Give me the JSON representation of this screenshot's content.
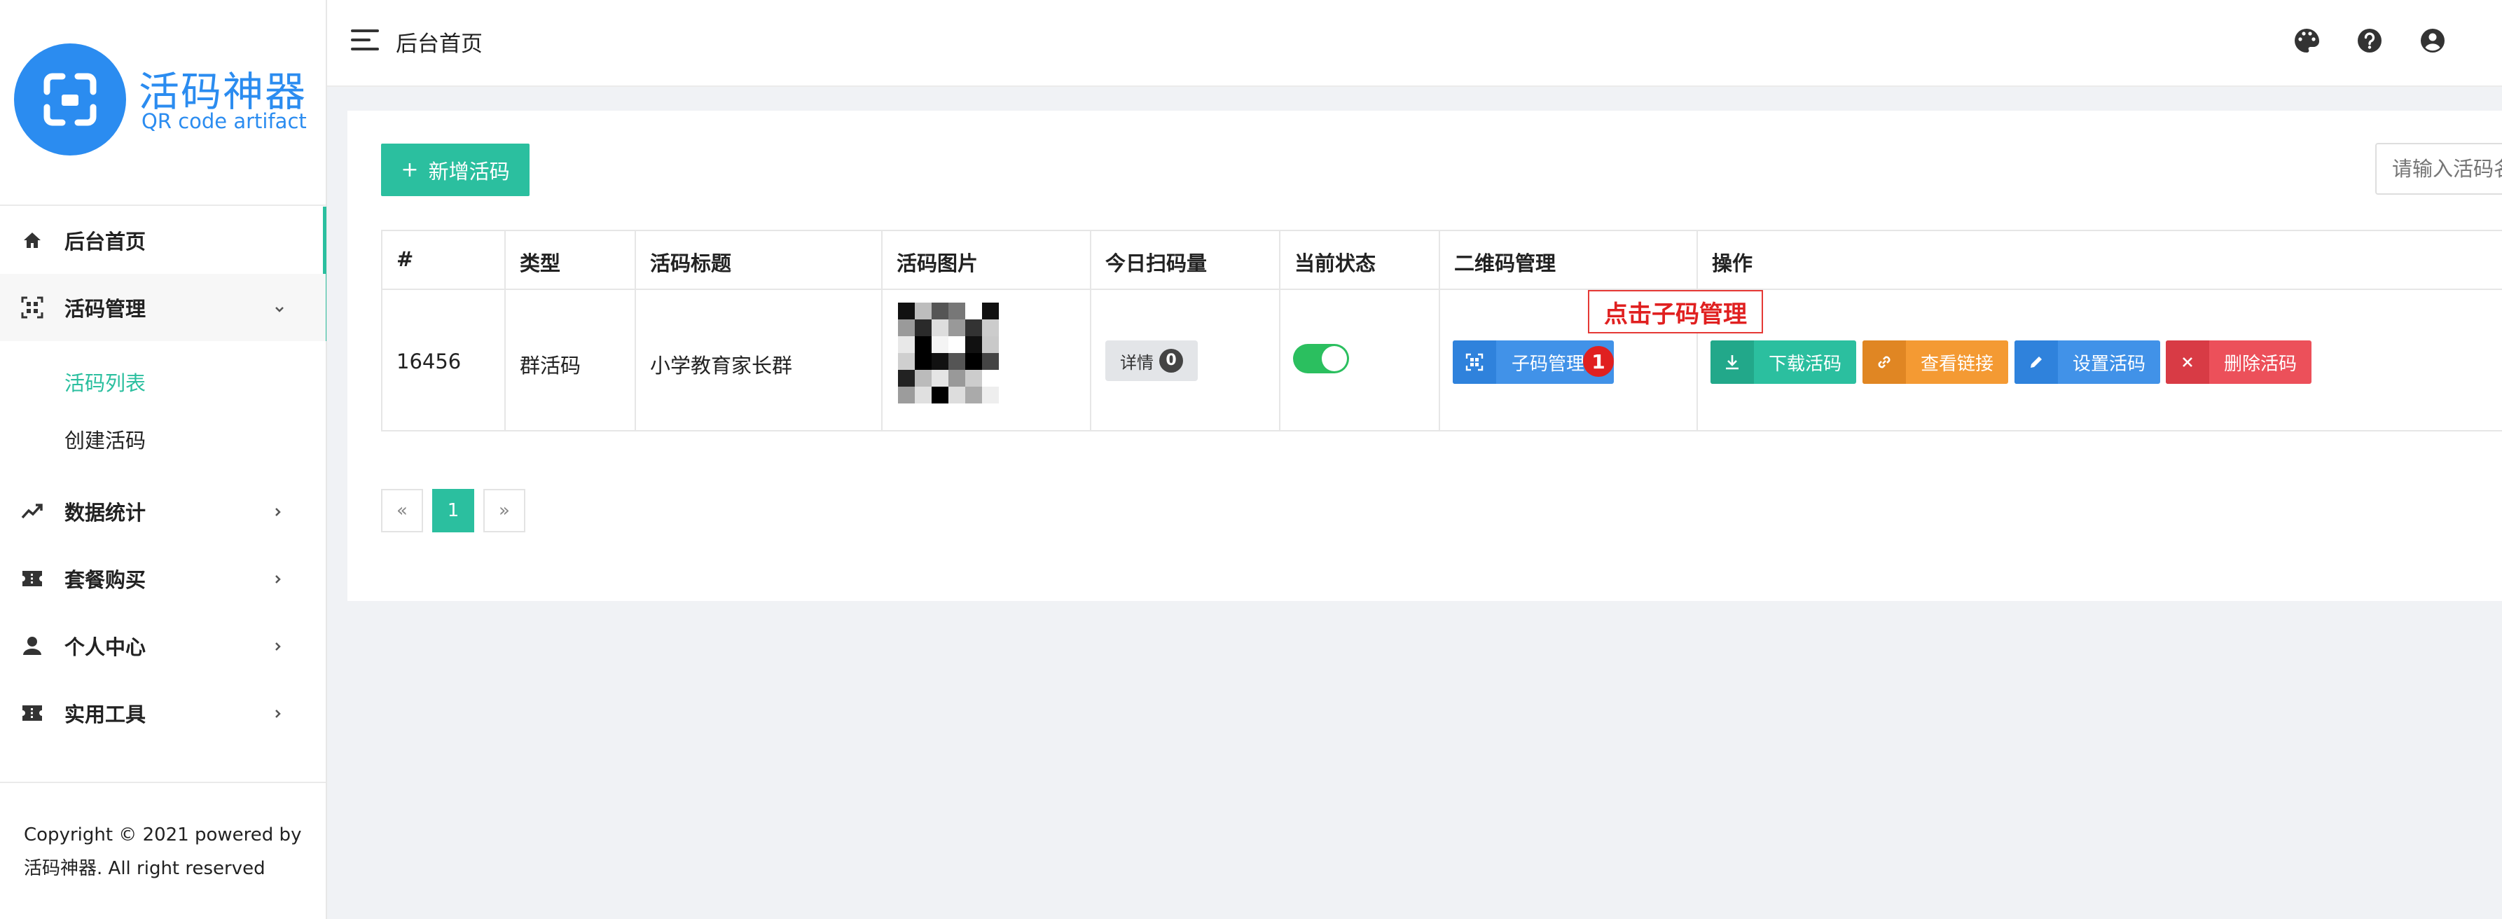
{
  "sidebar": {
    "logo_title": "活码神器",
    "logo_subtitle": "QR code artifact",
    "items": [
      {
        "label": "后台首页",
        "icon": "home-icon"
      },
      {
        "label": "活码管理",
        "icon": "qr-scan-icon"
      },
      {
        "label": "数据统计",
        "icon": "trend-icon"
      },
      {
        "label": "套餐购买",
        "icon": "ticket-icon"
      },
      {
        "label": "个人中心",
        "icon": "user-icon"
      },
      {
        "label": "实用工具",
        "icon": "ticket-icon"
      }
    ],
    "submenu": [
      {
        "label": "活码列表",
        "active": true
      },
      {
        "label": "创建活码",
        "active": false
      }
    ],
    "copyright_line1": "Copyright © 2021 powered by",
    "copyright_line2": "活码神器. All right reserved"
  },
  "header": {
    "title": "后台首页",
    "icons": [
      "palette-icon",
      "help-icon",
      "account-icon"
    ]
  },
  "toolbar": {
    "add_label": "新增活码",
    "search_placeholder": "请输入活码名称"
  },
  "table": {
    "headers": [
      "#",
      "类型",
      "活码标题",
      "活码图片",
      "今日扫码量",
      "当前状态",
      "二维码管理",
      "操作"
    ],
    "rows": [
      {
        "id": "16456",
        "type": "群活码",
        "title": "小学教育家长群",
        "detail_label": "详情",
        "scan_count": "0",
        "status_on": true,
        "qr_manage_label": "子码管理",
        "actions": {
          "download": "下载活码",
          "view_link": "查看链接",
          "settings": "设置活码",
          "delete": "删除活码"
        }
      }
    ]
  },
  "annotation": {
    "callout_text": "点击子码管理",
    "step_number": "1"
  },
  "pagination": {
    "prev": "«",
    "current": "1",
    "next": "»"
  },
  "colors": {
    "primary": "#2bbf9f",
    "brand_blue": "#2b8cf0",
    "download": "#26a78a",
    "view_link": "#f0952c",
    "settings": "#3f8fe6",
    "delete": "#e8464f",
    "annotation_red": "#e02020"
  }
}
